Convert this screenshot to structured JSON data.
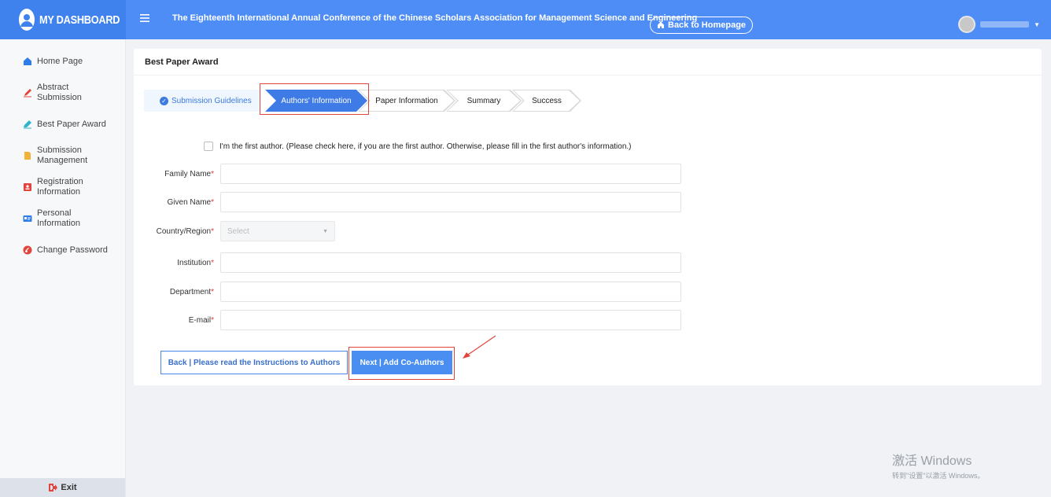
{
  "brand": {
    "title": "MY DASHBOARD"
  },
  "header": {
    "conference_title": "The Eighteenth International Annual Conference of the Chinese Scholars Association for Management Science and Engineering",
    "back_home_label": "Back to Homepage"
  },
  "sidebar": {
    "items": [
      {
        "label": "Home Page",
        "icon": "home-icon",
        "color": "#2f7ee8"
      },
      {
        "label": "Abstract Submission",
        "icon": "edit-icon",
        "color": "#e0463d"
      },
      {
        "label": "Best Paper Award",
        "icon": "pen-icon",
        "color": "#2fb5c9"
      },
      {
        "label": "Submission Management",
        "icon": "file-icon",
        "color": "#f2b23c"
      },
      {
        "label": "Registration Information",
        "icon": "id-card-icon",
        "color": "#e0463d"
      },
      {
        "label": "Personal Information",
        "icon": "profile-card-icon",
        "color": "#2f7ee8"
      },
      {
        "label": "Change Password",
        "icon": "key-icon",
        "color": "#e0463d"
      }
    ],
    "exit_label": "Exit"
  },
  "page": {
    "title": "Best Paper Award"
  },
  "steps": {
    "done": "Submission Guidelines",
    "active": "Authors' Information",
    "paper": "Paper Information",
    "summary": "Summary",
    "success": "Success"
  },
  "form": {
    "first_author_text": "I'm the first author. (Please check here, if you are the first author. Otherwise, please fill in the first author's information.)",
    "family_name": "Family Name",
    "given_name": "Given Name",
    "country": "Country/Region",
    "country_placeholder": "Select",
    "institution": "Institution",
    "department": "Department",
    "email": "E-mail",
    "required_mark": "*"
  },
  "buttons": {
    "back": "Back | Please read the Instructions to Authors",
    "next": "Next | Add Co-Authors"
  },
  "watermark": {
    "line1": "激活 Windows",
    "line2": "转到\"设置\"以激活 Windows。"
  }
}
